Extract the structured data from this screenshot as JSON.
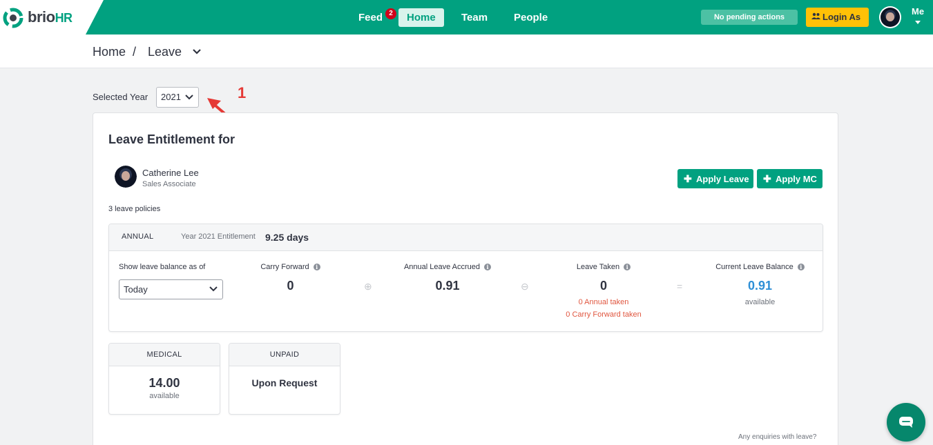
{
  "brand": {
    "name_a": "brio",
    "name_b": "HR",
    "accent": "#01a180"
  },
  "nav": {
    "feed": "Feed",
    "feed_badge": "2",
    "home": "Home",
    "team": "Team",
    "people": "People"
  },
  "header_right": {
    "pending": "No pending actions",
    "login_as": "Login As",
    "me": "Me"
  },
  "breadcrumb": {
    "home": "Home",
    "separator": "/",
    "current": "Leave"
  },
  "year": {
    "label": "Selected Year",
    "value": "2021"
  },
  "annotation": {
    "number": "1"
  },
  "card": {
    "title": "Leave Entitlement for",
    "employee": {
      "name": "Catherine Lee",
      "role": "Sales Associate"
    },
    "apply_leave": "Apply Leave",
    "apply_mc": "Apply MC",
    "policies_count": "3 leave policies",
    "annual": {
      "name": "ANNUAL",
      "entitlement_label": "Year 2021 Entitlement",
      "entitlement_value": "9.25 days",
      "balance_as_of_label": "Show leave balance as of",
      "balance_as_of_value": "Today",
      "carry_forward_label": "Carry Forward",
      "carry_forward_value": "0",
      "accrued_label": "Annual Leave Accrued",
      "accrued_value": "0.91",
      "taken_label": "Leave Taken",
      "taken_value": "0",
      "taken_annual": "0 Annual taken",
      "taken_cf": "0 Carry Forward taken",
      "balance_label": "Current Leave Balance",
      "balance_value": "0.91",
      "balance_sub": "available",
      "op_plus": "⊕",
      "op_minus": "⊖",
      "op_equals": "="
    },
    "medical": {
      "name": "MEDICAL",
      "value": "14.00",
      "sub": "available"
    },
    "unpaid": {
      "name": "UNPAID",
      "value": "Upon Request"
    },
    "enquiry": "Any enquiries with leave?"
  },
  "colors": {
    "balance_blue": "#2e8fd6",
    "taken_red": "#e0563f",
    "badge_red": "#d0021b",
    "login_yellow": "#ffc107"
  }
}
